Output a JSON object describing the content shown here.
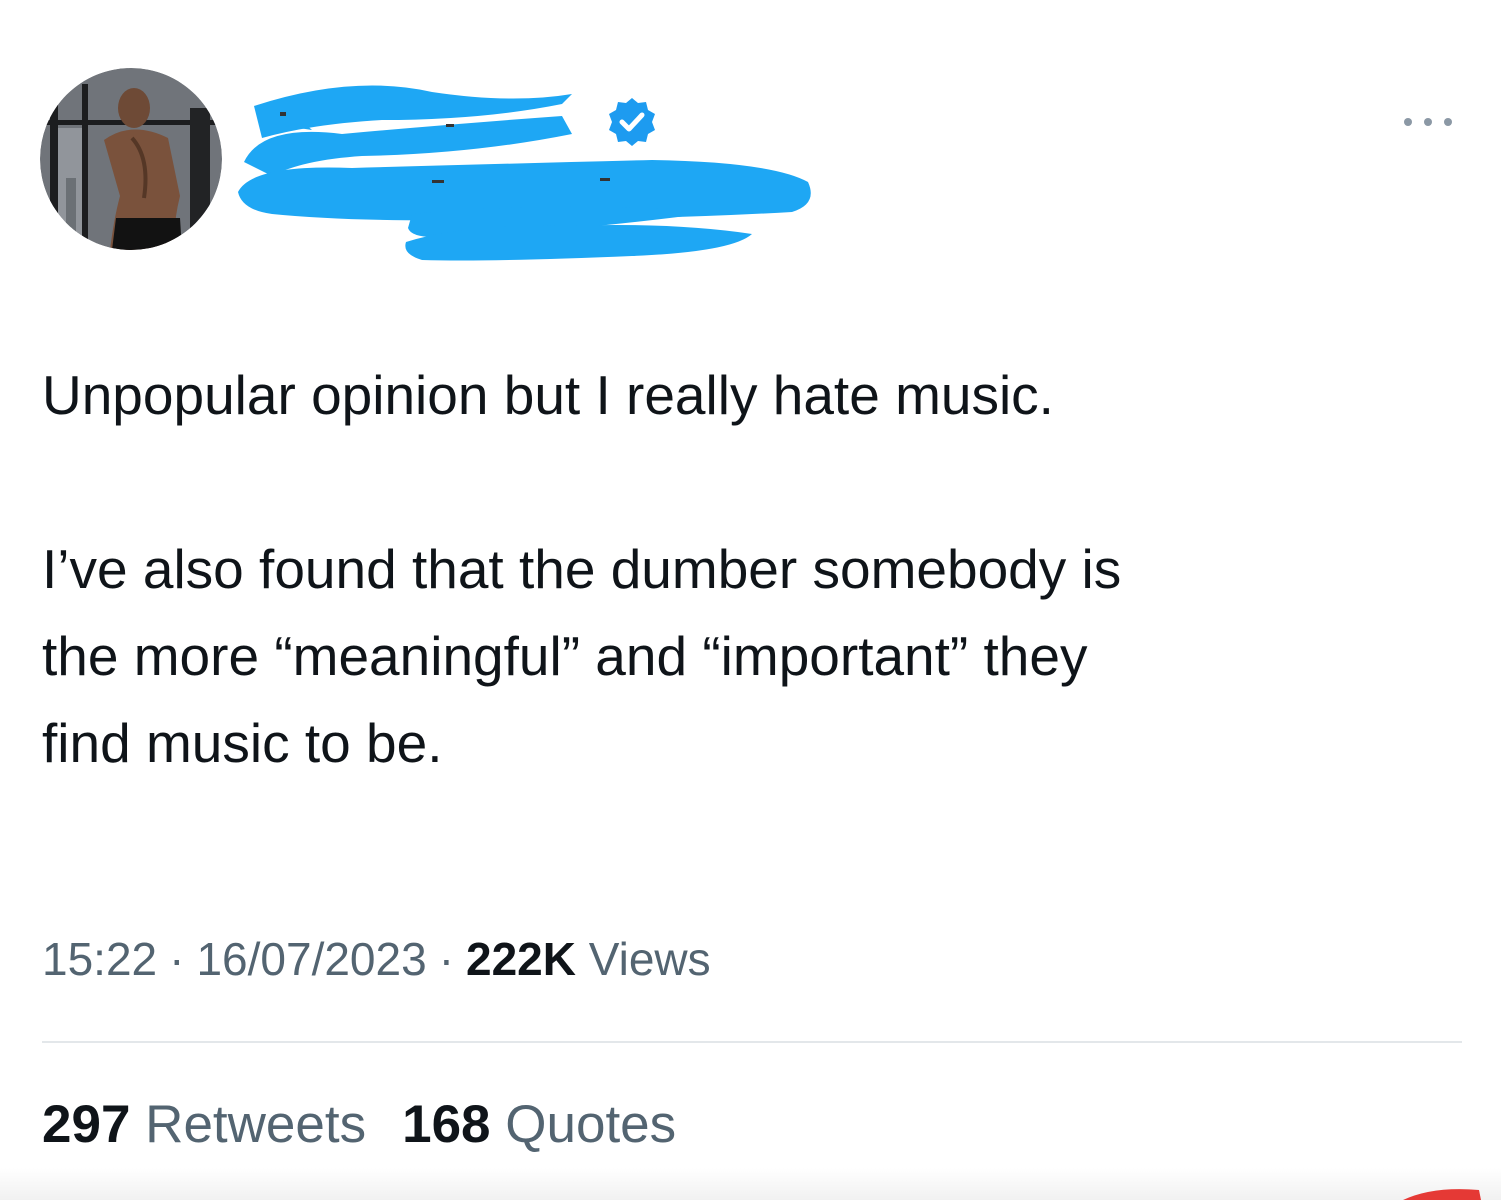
{
  "tweet": {
    "author": {
      "avatar_icon": "profile-avatar-icon",
      "verified_icon": "verified-badge-icon"
    },
    "more_icon": "more-options-icon",
    "text": {
      "paragraph_1": "Unpopular opinion but I really hate music.",
      "paragraph_2": "I’ve also found that the dumber somebody is\nthe more “meaningful” and “important” they\nfind music to be."
    },
    "meta": {
      "time": "15:22",
      "date": "16/07/2023",
      "separator": "·",
      "views_count": "222K",
      "views_label": "Views"
    },
    "stats": {
      "retweets_count": "297",
      "retweets_label": "Retweets",
      "quotes_count": "168",
      "quotes_label": "Quotes"
    },
    "colors": {
      "text_primary": "#0f1419",
      "text_secondary": "#536471",
      "verified_blue": "#1d9bf0",
      "redaction_blue": "#1ea7f4",
      "divider": "#e3e7ea"
    }
  }
}
